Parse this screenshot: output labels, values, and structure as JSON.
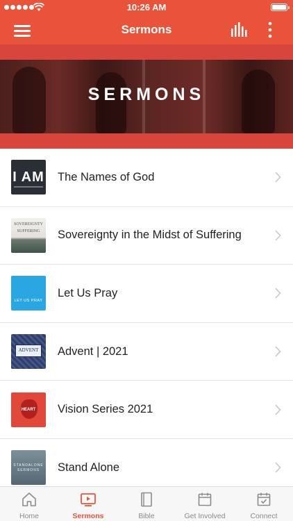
{
  "status_bar": {
    "time": "10:26 AM"
  },
  "nav": {
    "title": "Sermons"
  },
  "hero": {
    "title": "SERMONS"
  },
  "sermons": [
    {
      "title": "The Names of God",
      "thumb_text": "I AM"
    },
    {
      "title": "Sovereignty in the Midst of Suffering",
      "thumb_text": "SOVEREIGNTY",
      "thumb_text_2": "SUFFERING"
    },
    {
      "title": "Let Us Pray",
      "thumb_text": "LET US PRAY"
    },
    {
      "title": "Advent | 2021",
      "thumb_text": "ADVENT"
    },
    {
      "title": "Vision Series 2021",
      "thumb_text": "HEART"
    },
    {
      "title": "Stand Alone",
      "thumb_text": "STANDALONE SERMONS"
    }
  ],
  "tabs": [
    {
      "label": "Home",
      "icon": "home-icon",
      "active": false
    },
    {
      "label": "Sermons",
      "icon": "video-icon",
      "active": true
    },
    {
      "label": "Bible",
      "icon": "book-icon",
      "active": false
    },
    {
      "label": "Get Involved",
      "icon": "calendar-icon",
      "active": false
    },
    {
      "label": "Connect",
      "icon": "calendar-check-icon",
      "active": false
    }
  ],
  "colors": {
    "accent": "#e8533a",
    "hero_band": "#d8453c",
    "tab_inactive": "#8a8a8a"
  }
}
